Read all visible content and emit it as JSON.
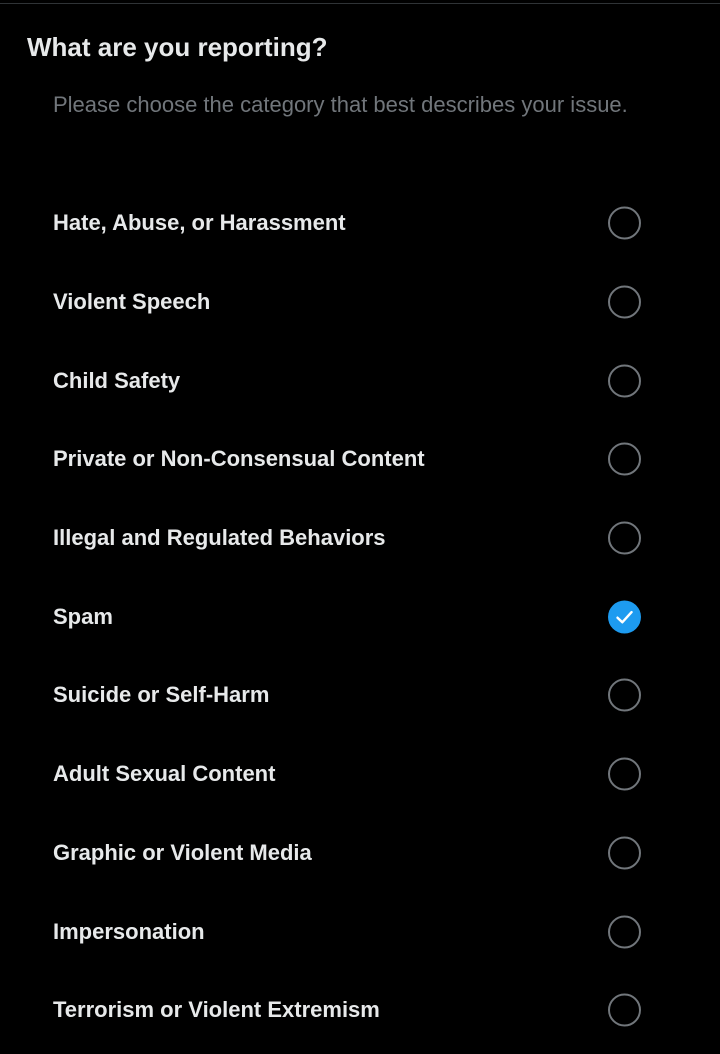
{
  "dialog": {
    "title": "What are you reporting?",
    "subtitle": "Please choose the category that best describes your issue."
  },
  "colors": {
    "background": "#000000",
    "text_primary": "#e7e9ea",
    "text_secondary": "#71767b",
    "radio_border": "#71767b",
    "accent": "#1d9bf0"
  },
  "options": [
    {
      "label": "Hate, Abuse, or Harassment",
      "checked": false,
      "icon": "radio-unchecked-icon"
    },
    {
      "label": "Violent Speech",
      "checked": false,
      "icon": "radio-unchecked-icon"
    },
    {
      "label": "Child Safety",
      "checked": false,
      "icon": "radio-unchecked-icon"
    },
    {
      "label": "Private or Non-Consensual Content",
      "checked": false,
      "icon": "radio-unchecked-icon"
    },
    {
      "label": "Illegal and Regulated Behaviors",
      "checked": false,
      "icon": "radio-unchecked-icon"
    },
    {
      "label": "Spam",
      "checked": true,
      "icon": "radio-checked-icon"
    },
    {
      "label": "Suicide or Self-Harm",
      "checked": false,
      "icon": "radio-unchecked-icon"
    },
    {
      "label": "Adult Sexual Content",
      "checked": false,
      "icon": "radio-unchecked-icon"
    },
    {
      "label": "Graphic or Violent Media",
      "checked": false,
      "icon": "radio-unchecked-icon"
    },
    {
      "label": "Impersonation",
      "checked": false,
      "icon": "radio-unchecked-icon"
    },
    {
      "label": "Terrorism or Violent Extremism",
      "checked": false,
      "icon": "radio-unchecked-icon"
    }
  ]
}
